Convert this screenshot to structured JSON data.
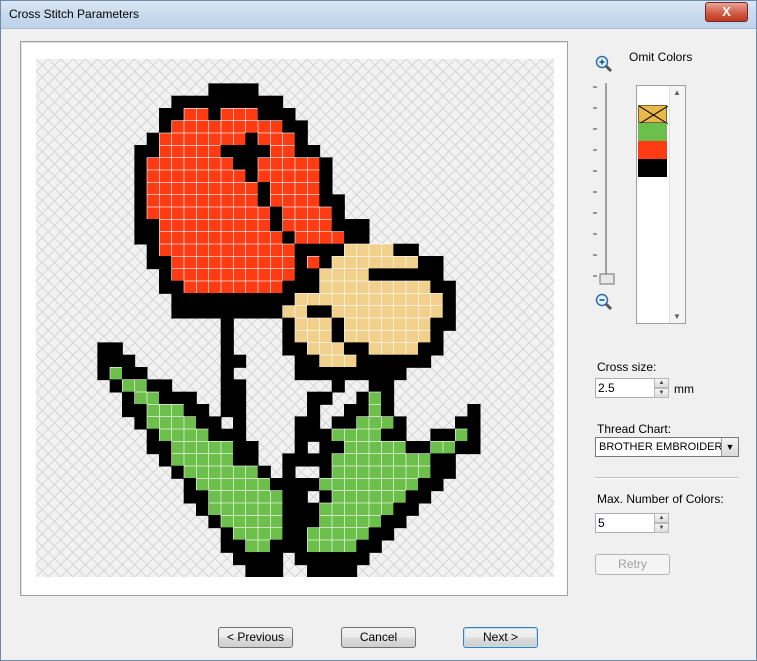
{
  "window": {
    "title": "Cross Stitch Parameters",
    "close_label": "X"
  },
  "preview": {
    "palette": [
      "#000000",
      "#ff3b13",
      "#f1d08c",
      "#6cbf4b"
    ],
    "rows": [
      "....................................",
      "....................................",
      "..............KKKK..................",
      "...........KKKKKKKKK................",
      "..........KKRRKRRRKKK...............",
      "..........KRRRRRRRRRKK..............",
      ".........KRRRRRRRKRRRK..............",
      "........KKRRRRRKKKKRRKK.............",
      "........KRRRRRRRKKRRRRRK............",
      "........KRRRRRRRRKRRRRRK............",
      "........KRRRRRRRRRKRRRRK............",
      "........KRRRRRRRRRKRRRRKK...........",
      "........KRRRRRRRRRRKRRRRK...........",
      "........KKRRRRRRRRRKRRRRKKK.........",
      "........KKRRRRRRRRRRKRRRRKK.........",
      ".........KRRRRRRRRRRRKKKKYYYYKK.....",
      ".........KKRRRRRRRRRRKRKYYYYYYYKK...",
      "..........KRRRRRRRRRRKKYYYYKKKKKK...",
      "..........KKRRRRRRRRKKKYYYYYYYYYKK..",
      "...........KKKKKKKKKKYYYYYYYYYYYYK..",
      "...........KKKKKKKKKYYKKYYYYYYYYYK..",
      "...............K....KYYYKYYYYYYYKK..",
      "...............K....KYYYKYYYYYYYK...",
      ".....KK........K....KKYYYKKYYYYKK...",
      ".....KKK.......KK....KKYYYKKKKKK....",
      ".....KGKK......K.....KKKKKKKKK......",
      "......KGGKK....KK.......K..KK.......",
      ".......KGGKKK..KK.....KK..KGK.......",
      ".......KKGGGKK.KK.....K..KKGK......K",
      "........KGGGGKK.K....KK.KKGGGK....KK",
      ".........KGGGGKKK....KKKGGGGKK..KKGK",
      ".........KKGGGGGKK...K.KKGGGGGKKGGKK",
      "..........KGGGGGKK..KKKKGGGGGGGGKK..",
      "...........KGGGGGGK.K..KGGGGGGGGKK..",
      "............KGGGGGGKKKKGGGGGGGGKK...",
      "............KKGGGGGGKK.KGGGGGGKK....",
      ".............KGGGGGGKKKGGGGGGKK.....",
      "..............KGGGGGKKKGGGGGKK......",
      "...............KGGGGKKGGGGGKK.......",
      "...............KKGGKKKGGGGKK........",
      "................KKKK.KKKKKK.........",
      ".................KKK..KKKK.........."
    ]
  },
  "zoom": {
    "level_fraction": 1.0
  },
  "omit_colors": {
    "label": "Omit Colors",
    "swatches": [
      "#ffffff",
      "#e9b84a",
      "#6cbf4b",
      "#ff3b13",
      "#000000"
    ]
  },
  "cross_size": {
    "label": "Cross size:",
    "value": "2.5",
    "unit": "mm"
  },
  "thread_chart": {
    "label": "Thread Chart:",
    "value": "BROTHER EMBROIDERY"
  },
  "max_colors": {
    "label": "Max. Number of Colors:",
    "value": "5"
  },
  "buttons": {
    "retry": "Retry",
    "previous": "< Previous",
    "cancel": "Cancel",
    "next": "Next >"
  }
}
